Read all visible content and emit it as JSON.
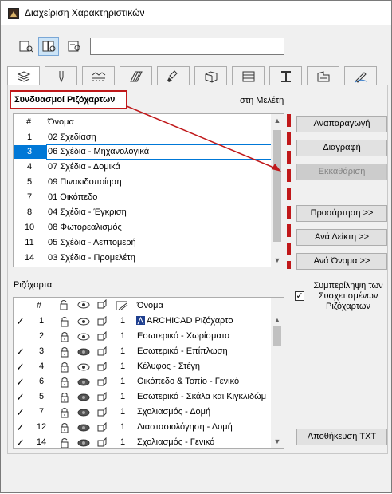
{
  "window": {
    "title": "Διαχείριση Χαρακτηριστικών"
  },
  "toolbar": {
    "buttons": [
      {
        "icon": "list-view-icon",
        "active": false
      },
      {
        "icon": "split-view-icon",
        "active": true
      },
      {
        "icon": "detail-view-icon",
        "active": false
      }
    ],
    "search_value": ""
  },
  "tabs": [
    {
      "icon": "layers-icon",
      "active": true
    },
    {
      "icon": "pen-icon"
    },
    {
      "icon": "line-types-icon"
    },
    {
      "icon": "fill-types-icon"
    },
    {
      "icon": "surfaces-icon"
    },
    {
      "icon": "building-materials-icon"
    },
    {
      "icon": "composites-icon"
    },
    {
      "icon": "profiles-icon"
    },
    {
      "icon": "zones-icon"
    },
    {
      "icon": "markup-icon"
    }
  ],
  "combinations": {
    "heading": "Συνδυασμοί Ριζόχαρτων",
    "in_project": "στη Μελέτη",
    "col_num": "#",
    "col_name": "Όνομα",
    "rows": [
      {
        "num": "1",
        "name": "02 Σχεδίαση"
      },
      {
        "num": "3",
        "name": "06 Σχέδια - Μηχανολογικά",
        "selected": true
      },
      {
        "num": "4",
        "name": "07 Σχέδια - Δομικά"
      },
      {
        "num": "5",
        "name": "09 Πινακιδοποίηση"
      },
      {
        "num": "7",
        "name": "01 Οικόπεδο"
      },
      {
        "num": "8",
        "name": "04 Σχέδια - Έγκριση"
      },
      {
        "num": "10",
        "name": "08 Φωτορεαλισμός"
      },
      {
        "num": "11",
        "name": "05 Σχέδια - Λεπτομερή"
      },
      {
        "num": "14",
        "name": "03 Σχέδια - Προμελέτη"
      }
    ]
  },
  "buttons": {
    "duplicate": "Αναπαραγωγή",
    "delete": "Διαγραφή",
    "clear": "Εκκαθάριση",
    "append": "Προσάρτηση >>",
    "by_index": "Ανά Δείκτη >>",
    "by_name": "Ανά Όνομα >>",
    "save_txt": "Αποθήκευση TXT"
  },
  "sheets": {
    "label": "Ριζόχαρτα",
    "col_num": "#",
    "col_name": "Όνομα",
    "include_label": "Συμπερίληψη των Συσχετισμένων Ριζόχαρτων",
    "include_checked": "✓",
    "rows": [
      {
        "check": "✓",
        "num": "1",
        "pen": "1",
        "name": "ARCHICAD Ριζόχαρτο",
        "lock": "unlocked",
        "eye": "open",
        "special": true
      },
      {
        "check": "",
        "num": "2",
        "pen": "1",
        "name": "Εσωτερικό - Χωρίσματα",
        "lock": "locked",
        "eye": "open"
      },
      {
        "check": "✓",
        "num": "3",
        "pen": "1",
        "name": "Εσωτερικό - Επίπλωση",
        "lock": "locked",
        "eye": "closed"
      },
      {
        "check": "✓",
        "num": "4",
        "pen": "1",
        "name": "Κέλυφος - Στέγη",
        "lock": "locked",
        "eye": "open"
      },
      {
        "check": "✓",
        "num": "6",
        "pen": "1",
        "name": "Οικόπεδο & Τοπίο - Γενικό",
        "lock": "locked",
        "eye": "closed"
      },
      {
        "check": "✓",
        "num": "5",
        "pen": "1",
        "name": "Εσωτερικό - Σκάλα και Κιγκλιδώμ",
        "lock": "locked",
        "eye": "closed"
      },
      {
        "check": "✓",
        "num": "7",
        "pen": "1",
        "name": "Σχολιασμός - Δομή",
        "lock": "locked",
        "eye": "closed"
      },
      {
        "check": "✓",
        "num": "12",
        "pen": "1",
        "name": "Διαστασιολόγηση - Δομή",
        "lock": "locked",
        "eye": "closed"
      },
      {
        "check": "✓",
        "num": "14",
        "pen": "1",
        "name": "Σχολιασμός - Γενικό",
        "lock": "unlocked",
        "eye": "closed"
      }
    ]
  },
  "colors": {
    "accent": "#0078d7",
    "annotation": "#c0181a"
  }
}
